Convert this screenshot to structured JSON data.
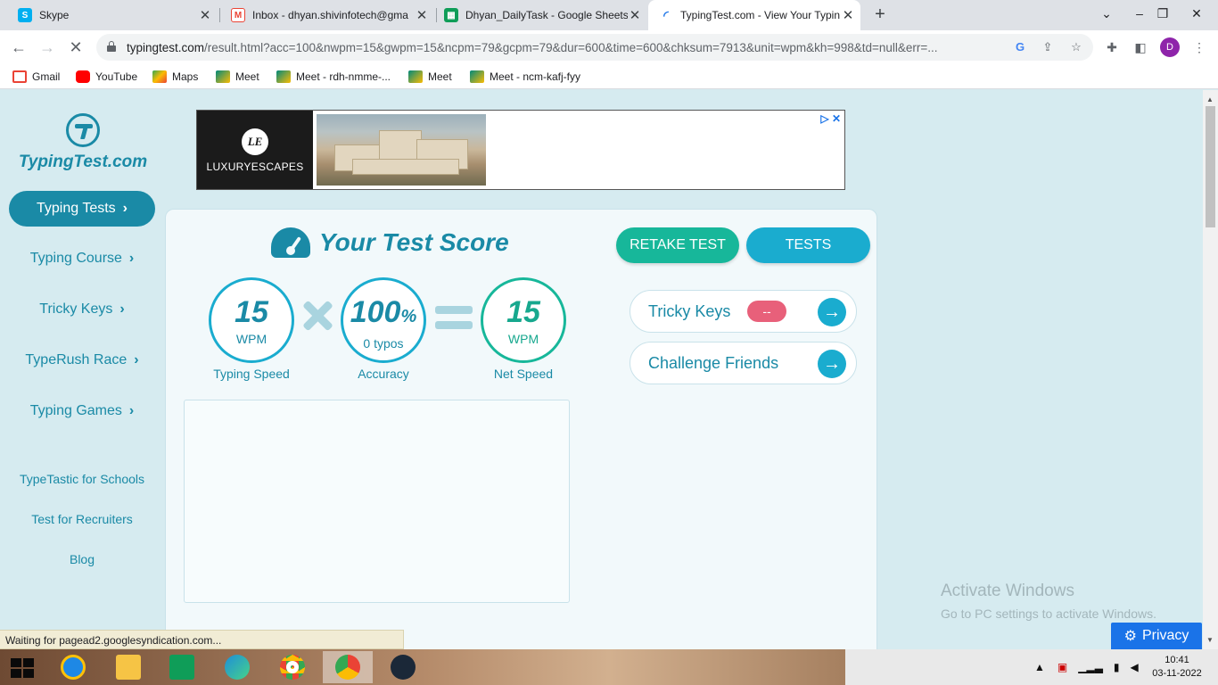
{
  "browser": {
    "tabs": [
      {
        "title": "Skype",
        "icon": "skype-icon",
        "color": "#00aff0",
        "active": false
      },
      {
        "title": "Inbox - dhyan.shivinfotech@gma",
        "icon": "gmail-icon",
        "color": "#ea4335",
        "active": false
      },
      {
        "title": "Dhyan_DailyTask - Google Sheets",
        "icon": "sheets-icon",
        "color": "#0f9d58",
        "active": false
      },
      {
        "title": "TypingTest.com - View Your Typin",
        "icon": "loading-icon",
        "color": "#1a73e8",
        "active": true
      }
    ],
    "url_host": "typingtest.com",
    "url_rest": "/result.html?acc=100&nwpm=15&gwpm=15&ncpm=79&gcpm=79&dur=600&time=600&chksum=7913&unit=wpm&kh=998&td=null&err=...",
    "profile_initial": "D",
    "bookmarks": [
      {
        "label": "Gmail",
        "icon": "gmail-icon",
        "color": "#ea4335"
      },
      {
        "label": "YouTube",
        "icon": "youtube-icon",
        "color": "#ff0000"
      },
      {
        "label": "Maps",
        "icon": "maps-icon",
        "color": "#34a853"
      },
      {
        "label": "Meet",
        "icon": "meet-icon",
        "color": "#00897b"
      },
      {
        "label": "Meet - rdh-nmme-...",
        "icon": "meet-icon",
        "color": "#00897b"
      },
      {
        "label": "Meet",
        "icon": "meet-icon",
        "color": "#00897b"
      },
      {
        "label": "Meet - ncm-kafj-fyy",
        "icon": "meet-icon",
        "color": "#00897b"
      }
    ]
  },
  "site": {
    "logo_text": "TypingTest.com",
    "nav_active": "Typing Tests",
    "nav": [
      "Typing Course",
      "Tricky Keys",
      "TypeRush Race",
      "Typing Games"
    ],
    "links": [
      "TypeTastic for Schools",
      "Test for Recruiters",
      "Blog"
    ]
  },
  "ad": {
    "brand": "LUXURYESCAPES",
    "monogram": "LE"
  },
  "score": {
    "title": "Your Test Score",
    "retake_label": "RETAKE TEST",
    "tests_label": "TESTS",
    "typing_speed": {
      "value": "15",
      "unit": "WPM",
      "caption": "Typing Speed"
    },
    "accuracy": {
      "value": "100",
      "pct": "%",
      "sub": "0  typos",
      "caption": "Accuracy"
    },
    "net_speed": {
      "value": "15",
      "unit": "WPM",
      "caption": "Net Speed"
    },
    "tricky_keys_label": "Tricky Keys",
    "tricky_keys_badge": "--",
    "challenge_label": "Challenge Friends"
  },
  "overlay": {
    "activate_title": "Activate Windows",
    "activate_sub": "Go to PC settings to activate Windows.",
    "privacy_label": "Privacy",
    "status_text": "Waiting for pagead2.googlesyndication.com..."
  },
  "taskbar": {
    "time": "10:41",
    "date": "03-11-2022"
  },
  "colors": {
    "brand": "#1a8aa6",
    "retake": "#17b79a",
    "tests": "#1aaccf",
    "badge": "#e8607a"
  }
}
